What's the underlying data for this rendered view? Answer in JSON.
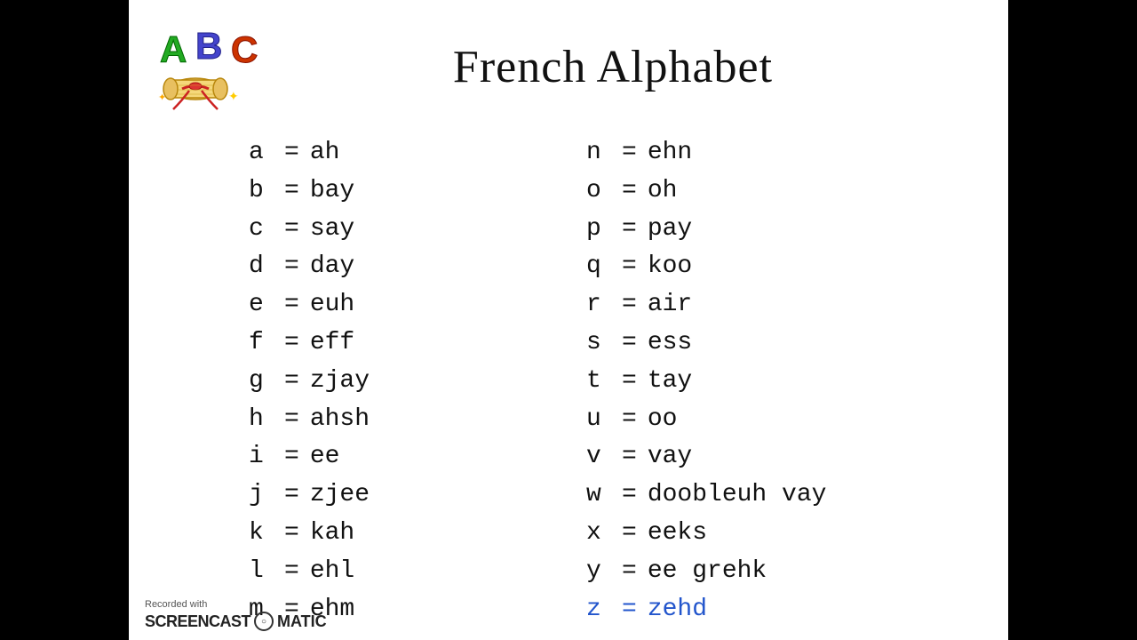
{
  "title": "French Alphabet",
  "left_column": [
    {
      "letter": "a",
      "eq": "=",
      "pronunciation": "ah",
      "highlight": false
    },
    {
      "letter": "b",
      "eq": "=",
      "pronunciation": "bay",
      "highlight": false
    },
    {
      "letter": "c",
      "eq": "=",
      "pronunciation": "say",
      "highlight": false
    },
    {
      "letter": "d",
      "eq": "=",
      "pronunciation": "day",
      "highlight": false
    },
    {
      "letter": "e",
      "eq": "=",
      "pronunciation": "euh",
      "highlight": false
    },
    {
      "letter": "f",
      "eq": "=",
      "pronunciation": "eff",
      "highlight": false
    },
    {
      "letter": "g",
      "eq": "=",
      "pronunciation": "zjay",
      "highlight": false
    },
    {
      "letter": "h",
      "eq": "=",
      "pronunciation": "ahsh",
      "highlight": false
    },
    {
      "letter": "i",
      "eq": "=",
      "pronunciation": "ee",
      "highlight": false
    },
    {
      "letter": "j",
      "eq": "=",
      "pronunciation": "zjee",
      "highlight": false
    },
    {
      "letter": "k",
      "eq": "=",
      "pronunciation": "kah",
      "highlight": false
    },
    {
      "letter": "l",
      "eq": "=",
      "pronunciation": "ehl",
      "highlight": false
    },
    {
      "letter": "m",
      "eq": "=",
      "pronunciation": "ehm",
      "highlight": false
    }
  ],
  "right_column": [
    {
      "letter": "n",
      "eq": "=",
      "pronunciation": "ehn",
      "highlight": false
    },
    {
      "letter": "o",
      "eq": "=",
      "pronunciation": "oh",
      "highlight": false
    },
    {
      "letter": "p",
      "eq": "=",
      "pronunciation": "pay",
      "highlight": false
    },
    {
      "letter": "q",
      "eq": "=",
      "pronunciation": "koo",
      "highlight": false
    },
    {
      "letter": "r",
      "eq": "=",
      "pronunciation": "air",
      "highlight": false
    },
    {
      "letter": "s",
      "eq": "=",
      "pronunciation": "ess",
      "highlight": false
    },
    {
      "letter": "t",
      "eq": "=",
      "pronunciation": "tay",
      "highlight": false
    },
    {
      "letter": "u",
      "eq": "=",
      "pronunciation": "oo",
      "highlight": false
    },
    {
      "letter": "v",
      "eq": "=",
      "pronunciation": "vay",
      "highlight": false
    },
    {
      "letter": "w",
      "eq": "=",
      "pronunciation": "doobleuh vay",
      "highlight": false
    },
    {
      "letter": "x",
      "eq": "=",
      "pronunciation": "eeks",
      "highlight": false
    },
    {
      "letter": "y",
      "eq": "=",
      "pronunciation": "ee grehk",
      "highlight": false
    },
    {
      "letter": "z",
      "eq": "=",
      "pronunciation": "zehd",
      "highlight": true
    }
  ],
  "footer": {
    "recorded_with": "Recorded with",
    "brand": "SCREENCAST",
    "brand2": "MATIC"
  }
}
